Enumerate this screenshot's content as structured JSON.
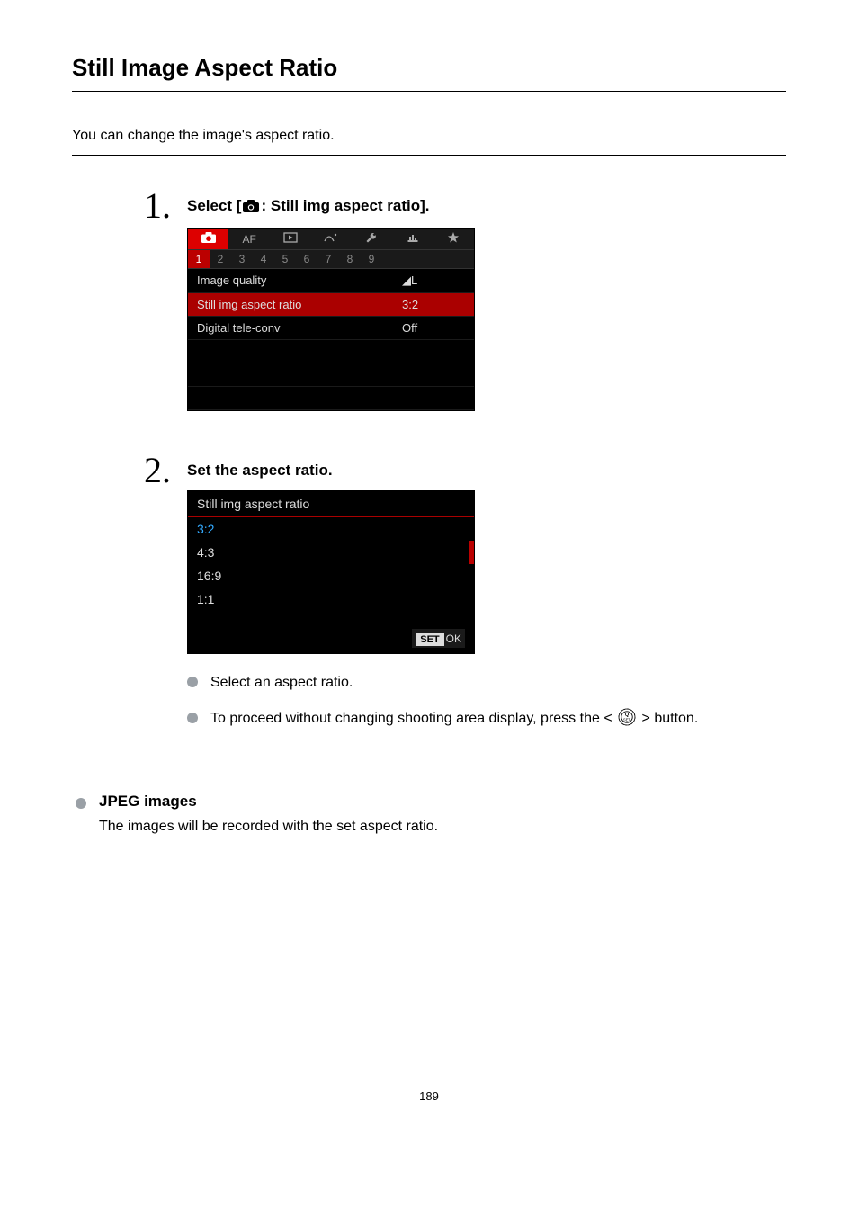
{
  "title": "Still Image Aspect Ratio",
  "intro": "You can change the image's aspect ratio.",
  "steps": {
    "1": {
      "num": "1.",
      "title_prefix": "Select [",
      "title_suffix": ": Still img aspect ratio].",
      "menu": {
        "tab_af": "AF",
        "subtabs": [
          "1",
          "2",
          "3",
          "4",
          "5",
          "6",
          "7",
          "8",
          "9"
        ],
        "active_subtab": 0,
        "rows": [
          {
            "label": "Image quality",
            "value": "◢L",
            "selected": false
          },
          {
            "label": "Still img aspect ratio",
            "value": "3:2",
            "selected": true
          },
          {
            "label": "Digital tele-conv",
            "value": "Off",
            "selected": false
          }
        ]
      }
    },
    "2": {
      "num": "2.",
      "title": "Set the aspect ratio.",
      "ratio_screen": {
        "header": "Still img aspect ratio",
        "options": [
          {
            "label": "3:2",
            "current": true,
            "selected": false
          },
          {
            "label": "4:3",
            "current": false,
            "selected": true
          },
          {
            "label": "16:9",
            "current": false,
            "selected": false
          },
          {
            "label": "1:1",
            "current": false,
            "selected": false
          }
        ],
        "set_label": "SET",
        "ok_label": "OK"
      },
      "bullets": [
        {
          "text": "Select an aspect ratio."
        },
        {
          "prefix": "To proceed without changing shooting area display, press the < ",
          "suffix": " > button."
        }
      ]
    }
  },
  "section": {
    "heading": "JPEG images",
    "body": "The images will be recorded with the set aspect ratio."
  },
  "page_number": "189"
}
